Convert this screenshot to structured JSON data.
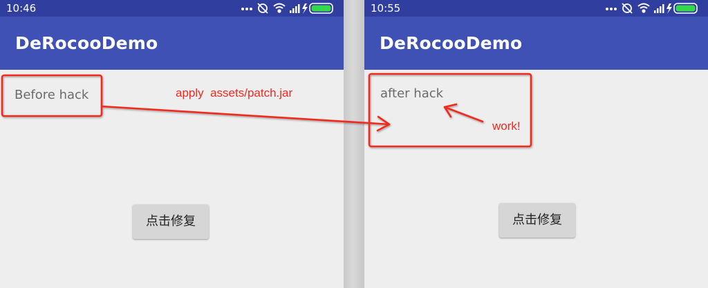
{
  "colors": {
    "status_bar": "#303f9f",
    "app_bar": "#3f51b5",
    "background": "#eeeeee",
    "annotation": "#f02a1f"
  },
  "left_screen": {
    "status_time": "10:46",
    "app_title": "DeRocooDemo",
    "content_text": "Before hack",
    "button_label": "点击修复"
  },
  "right_screen": {
    "status_time": "10:55",
    "app_title": "DeRocooDemo",
    "content_text": "after hack",
    "button_label": "点击修复"
  },
  "status_icons": [
    "more-dots-icon",
    "alarm-icon",
    "wifi-icon",
    "signal-icon",
    "charging-icon",
    "battery-icon"
  ],
  "annotations": {
    "apply": "apply  assets/patch.jar",
    "work": "work!"
  }
}
